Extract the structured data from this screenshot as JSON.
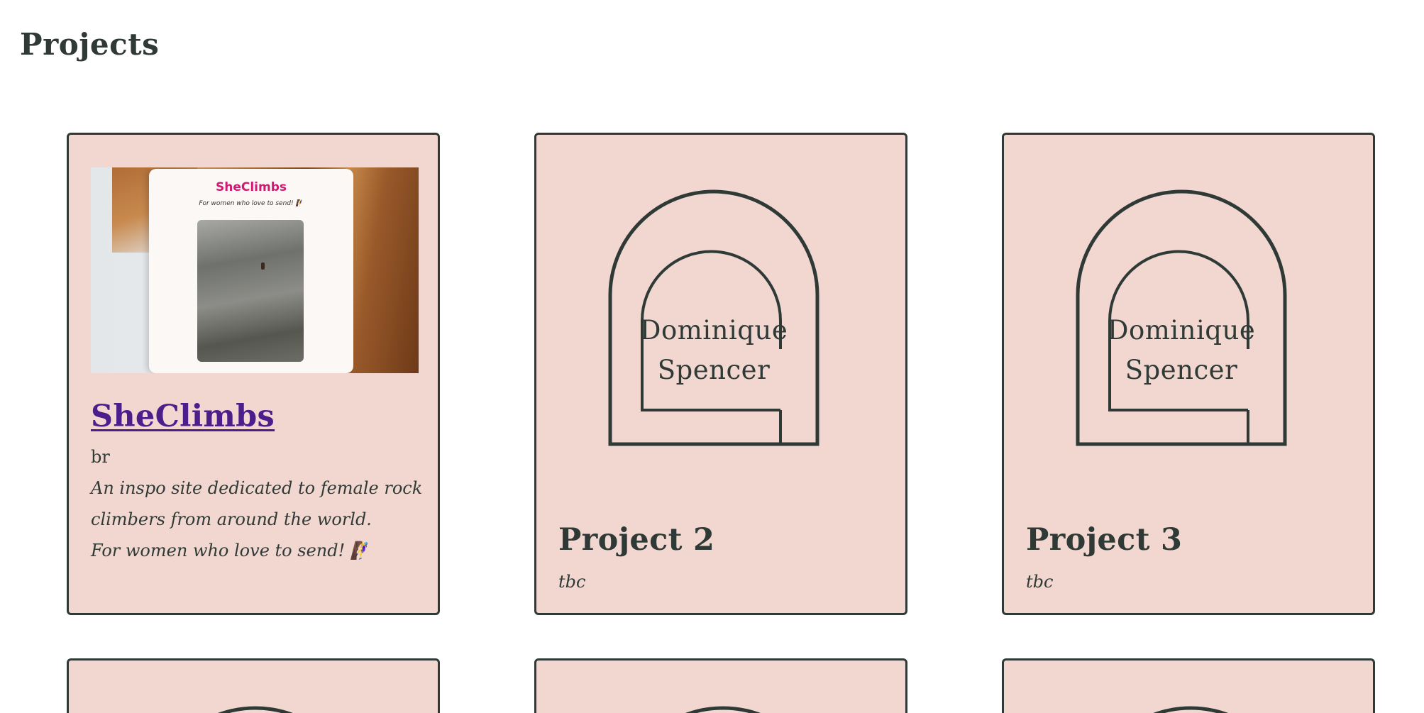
{
  "page": {
    "title": "Projects"
  },
  "projects": [
    {
      "title": "SheClimbs",
      "subtitle": "br",
      "description": [
        "An inspo site dedicated to female rock",
        "climbers from around the world.",
        "For women who love to send! 🧗‍♀️"
      ],
      "thumbnail": {
        "brand": "SheClimbs",
        "tagline": "For women who love to send! 🧗‍♀️"
      }
    },
    {
      "title": "Project 2",
      "description": "tbc",
      "logo": {
        "line1": "Dominique",
        "line2": "Spencer"
      }
    },
    {
      "title": "Project 3",
      "description": "tbc",
      "logo": {
        "line1": "Dominique",
        "line2": "Spencer"
      }
    }
  ],
  "colors": {
    "card_background": "#f2d7d1",
    "border": "#2f3a36",
    "text": "#2f3a36",
    "link": "#4b1e8c",
    "brand_pink": "#d01b72"
  }
}
